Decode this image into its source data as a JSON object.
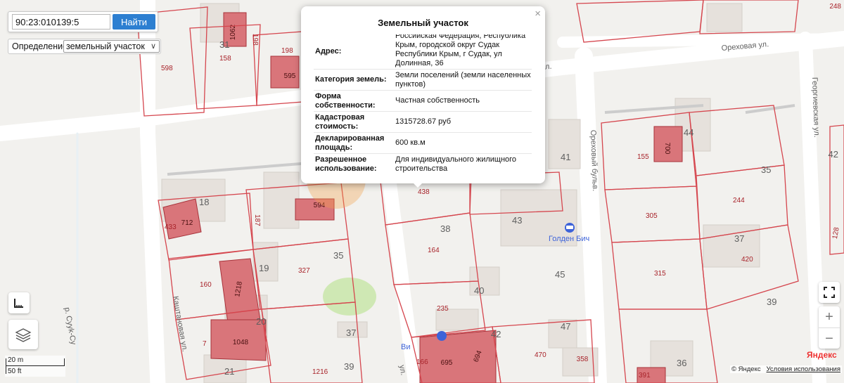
{
  "search": {
    "value": "90:23:010139:5",
    "button_label": "Найти"
  },
  "definition": {
    "label": "Определение:",
    "selected": "земельный участок"
  },
  "popup": {
    "title": "Земельный участок",
    "close_glyph": "×",
    "rows": [
      {
        "label": "Адрес:",
        "value": "Российская Федерация, Республика Крым, городской округ Судак Республики Крым, г Судак, ул Долинная, 36"
      },
      {
        "label": "Категория земель:",
        "value": "Земли поселений (земли населенных пунктов)"
      },
      {
        "label": "Форма собственности:",
        "value": "Частная собственность"
      },
      {
        "label": "Кадастровая стоимость:",
        "value": "1315728.67 руб"
      },
      {
        "label": "Декларированная площадь:",
        "value": "600 кв.м"
      },
      {
        "label": "Разрешенное использование:",
        "value": "Для индивидуального жилищного строительства"
      }
    ]
  },
  "streets": {
    "orekhovaya": "Ореховая ул.",
    "georgievskaya": "Георгиевская ул.",
    "orekhovy_bulv": "Ореховый бульв.",
    "kashtanovaya": "Каштановая ул.",
    "dolinnaya": "ул.",
    "river": "р. Сууk-Су",
    "top_ul": "ул."
  },
  "house_numbers": [
    "31",
    "18",
    "35",
    "19",
    "20",
    "37",
    "21",
    "39",
    "38",
    "43",
    "40",
    "42",
    "47",
    "45",
    "44",
    "41",
    "35",
    "37",
    "39",
    "36",
    "42"
  ],
  "parcel_numbers": [
    "598",
    "158",
    "198",
    "198",
    "433",
    "187",
    "160",
    "327",
    "7",
    "1216",
    "164",
    "235",
    "166",
    "470",
    "155",
    "305",
    "244",
    "315",
    "420",
    "438",
    "391"
  ],
  "building_labels": [
    "1062",
    "595",
    "712",
    "594",
    "1218",
    "1048",
    "695",
    "694",
    "700",
    "358",
    "248",
    "128"
  ],
  "poi": {
    "hotel": "Голден Бич",
    "vi": "Ви"
  },
  "controls": {
    "ruler_icon": "ruler-icon",
    "layers_icon": "layers-icon",
    "fullscreen_icon": "fullscreen-icon",
    "zoom_in": "+",
    "zoom_out": "−"
  },
  "scale": {
    "metric": "20 m",
    "imperial": "50 ft"
  },
  "branding": {
    "logo": "Яндекс",
    "copyright": "© Яндекс",
    "terms": "Условия использования"
  },
  "colors": {
    "parcel_border": "#d5464e",
    "building_fill": "#d9757a",
    "road": "#ffffff",
    "background": "#f2f1ee",
    "button": "#2d7fd1"
  }
}
